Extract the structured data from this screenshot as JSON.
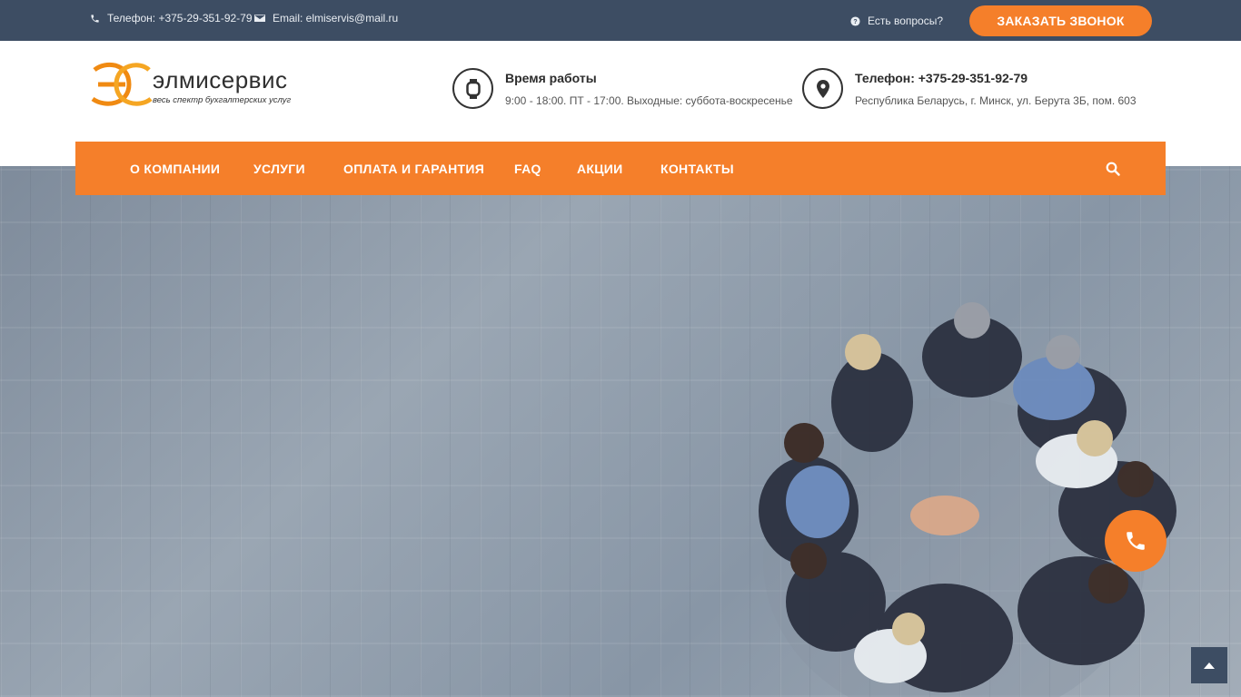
{
  "topbar": {
    "phone_text": "Телефон: +375-29-351-92-79",
    "email_text": "Email: elmiservis@mail.ru",
    "questions_text": "Есть вопросы?",
    "callback_button": "ЗАКАЗАТЬ ЗВОНОК",
    "icons": {
      "phone": "phone-icon",
      "email": "envelope-icon",
      "questions": "question-circle-icon"
    }
  },
  "header": {
    "logo": {
      "wordmark": "элмисервис",
      "tagline": "весь спектр бухгалтерских услуг"
    },
    "hours": {
      "title": "Время работы",
      "text": "9:00 - 18:00. ПТ - 17:00. Выходные: суббота-воскресенье",
      "icon": "watch-icon"
    },
    "address": {
      "title": "Телефон: +375-29-351-92-79",
      "text": "Республика Беларусь, г. Минск, ул. Берута 3Б, пом. 603",
      "icon": "map-marker-icon"
    }
  },
  "nav": {
    "items": [
      {
        "label": "О КОМПАНИИ"
      },
      {
        "label": "УСЛУГИ"
      },
      {
        "label": "ОПЛАТА И ГАРАНТИЯ"
      },
      {
        "label": "FAQ"
      },
      {
        "label": "АКЦИИ"
      },
      {
        "label": "КОНТАКТЫ"
      }
    ],
    "search_icon": "search-icon"
  },
  "floating": {
    "call_icon": "phone-icon",
    "top_icon": "arrow-up-icon"
  },
  "colors": {
    "topbar_bg": "#3d4d63",
    "accent": "#f57f2a",
    "text_dark": "#2c2c2c"
  }
}
